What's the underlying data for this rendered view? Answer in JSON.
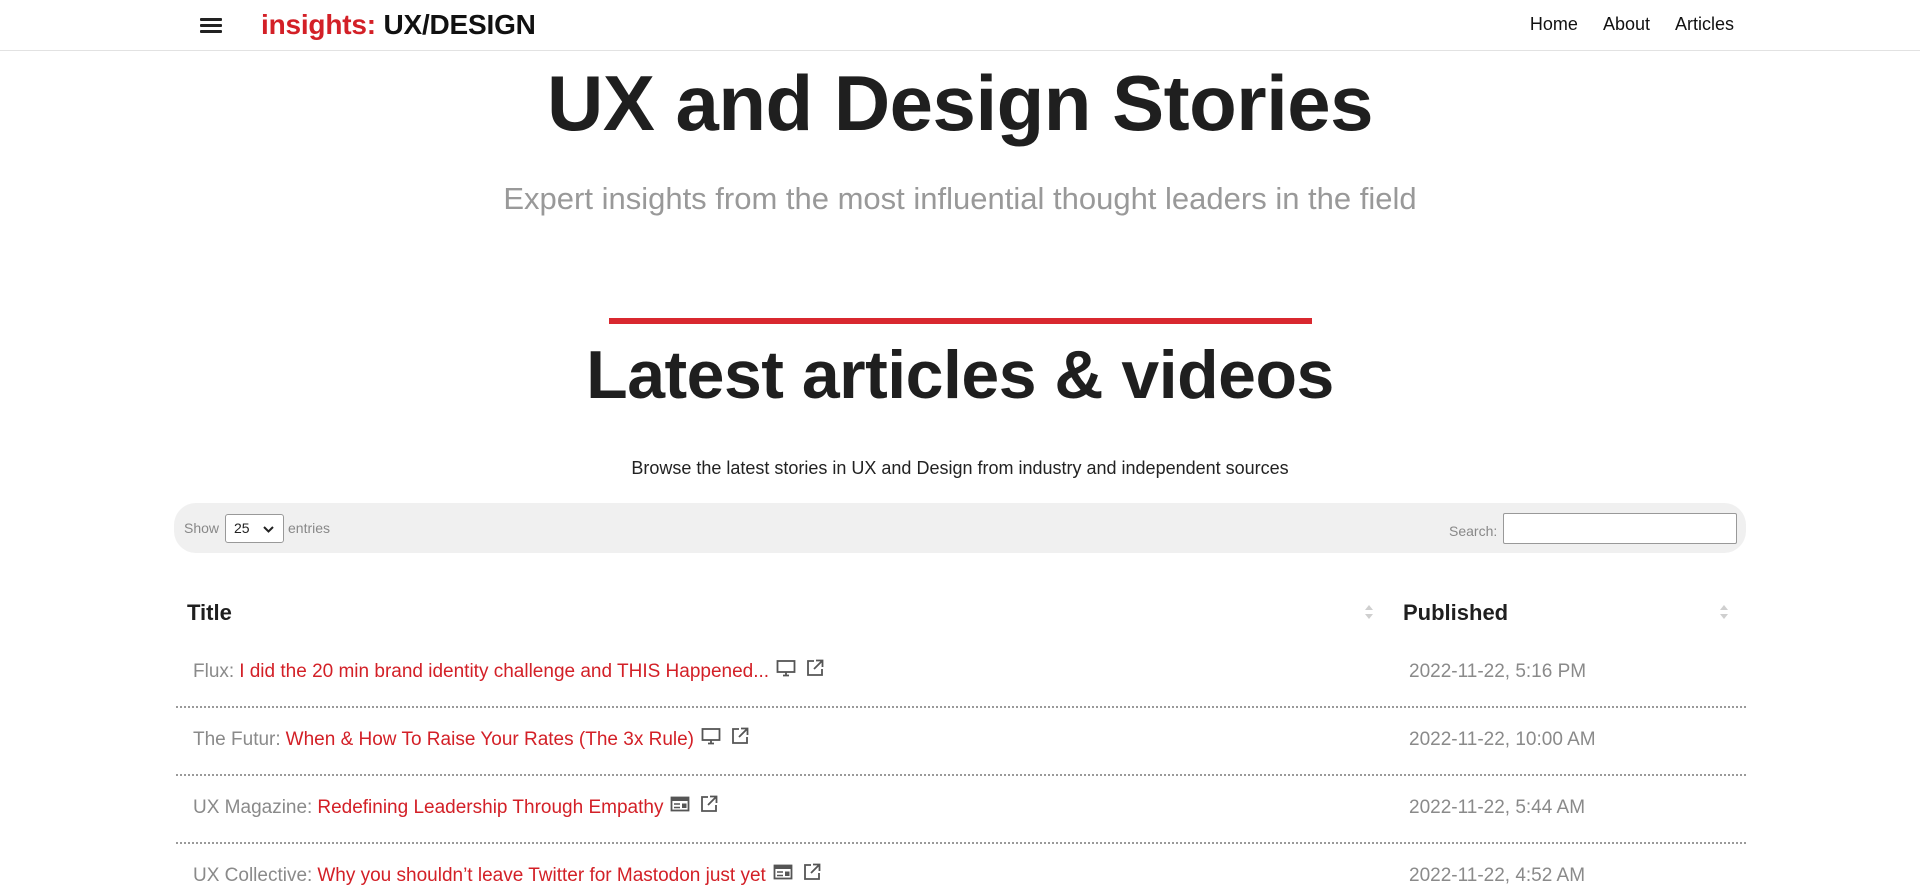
{
  "nav": {
    "brand_accent": "insights:",
    "brand_rest": " UX/DESIGN",
    "links": [
      "Home",
      "About",
      "Articles"
    ]
  },
  "hero": {
    "title": "UX and Design Stories",
    "subtitle": "Expert insights from the most influential thought leaders in the field"
  },
  "section": {
    "title": "Latest articles & videos",
    "description": "Browse the latest stories in UX and Design from industry and independent sources"
  },
  "controls": {
    "show_label": "Show",
    "show_value": "25",
    "entries_label": "entries",
    "search_label": "Search:",
    "search_value": ""
  },
  "table": {
    "headers": [
      "Title",
      "Published"
    ],
    "rows": [
      {
        "source": "Flux:",
        "title": "I did the 20 min brand identity challenge and THIS Happened...",
        "type_icon": "video-icon",
        "date": "2022-11-22, 5:16 PM"
      },
      {
        "source": "The Futur:",
        "title": "When & How To Raise Your Rates (The 3x Rule)",
        "type_icon": "video-icon",
        "date": "2022-11-22, 10:00 AM"
      },
      {
        "source": "UX Magazine:",
        "title": "Redefining Leadership Through Empathy",
        "type_icon": "article-icon",
        "date": "2022-11-22, 5:44 AM"
      },
      {
        "source": "UX Collective:",
        "title": "Why you shouldn’t leave Twitter for Mastodon just yet",
        "type_icon": "article-icon",
        "date": "2022-11-22, 4:52 AM"
      }
    ]
  },
  "colors": {
    "accent": "#d32027",
    "muted_text": "#8a8a8a",
    "toolbar_bg": "#f0f0f0"
  }
}
